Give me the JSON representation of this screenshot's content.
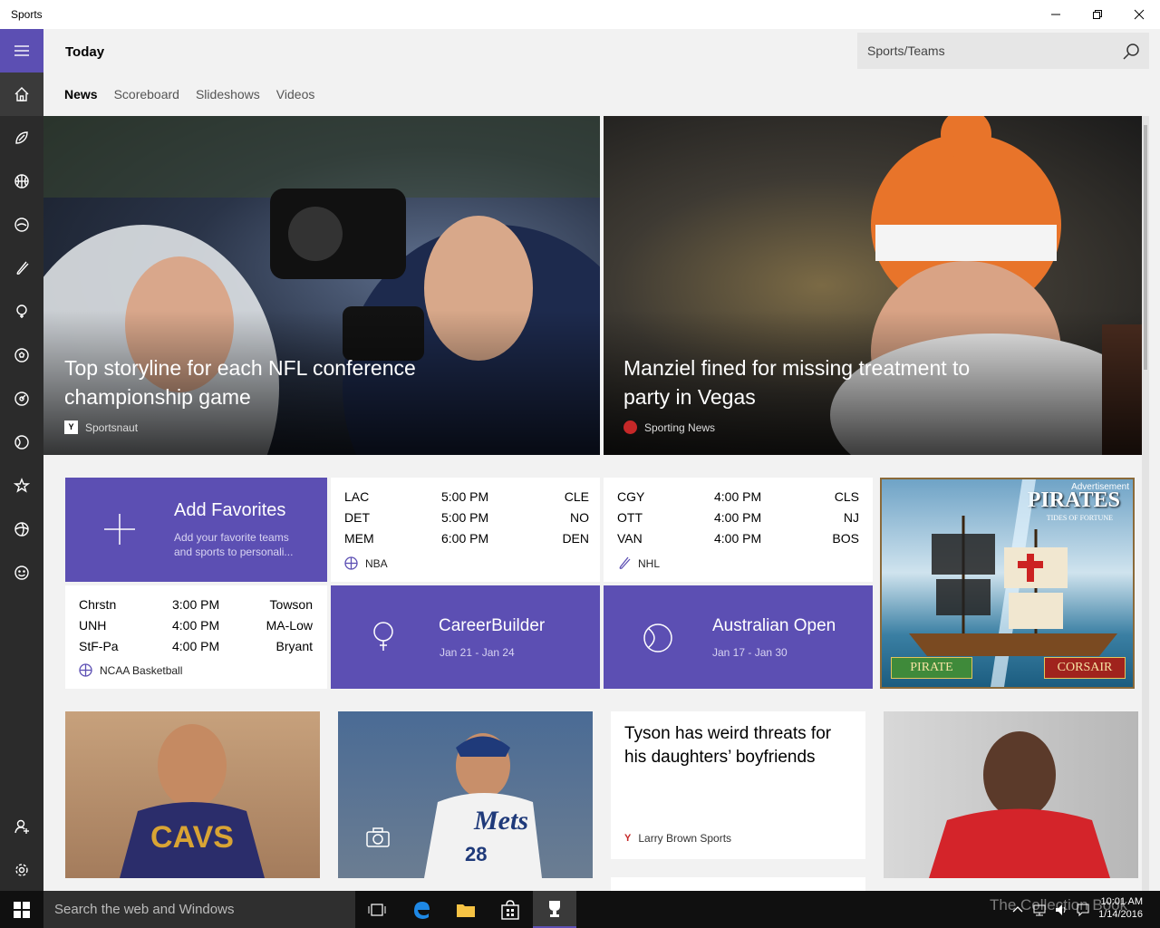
{
  "window": {
    "title": "Sports"
  },
  "header": {
    "page_title": "Today",
    "search_placeholder": "Sports/Teams",
    "tabs": [
      {
        "label": "News",
        "active": true
      },
      {
        "label": "Scoreboard",
        "active": false
      },
      {
        "label": "Slideshows",
        "active": false
      },
      {
        "label": "Videos",
        "active": false
      }
    ]
  },
  "sidebar": {
    "items": [
      {
        "icon": "home-icon",
        "active": true
      },
      {
        "icon": "football-icon"
      },
      {
        "icon": "basketball-icon"
      },
      {
        "icon": "hockey-puck-icon"
      },
      {
        "icon": "hockey-stick-icon"
      },
      {
        "icon": "golf-icon"
      },
      {
        "icon": "soccer-ball-icon"
      },
      {
        "icon": "racing-icon"
      },
      {
        "icon": "tennis-icon"
      },
      {
        "icon": "favorites-icon"
      },
      {
        "icon": "more-sports-icon"
      },
      {
        "icon": "fantasy-icon"
      }
    ],
    "bottom": [
      {
        "icon": "account-icon"
      },
      {
        "icon": "settings-icon"
      }
    ]
  },
  "heroes": [
    {
      "headline": "Top storyline for each NFL conference championship game",
      "source": "Sportsnaut"
    },
    {
      "headline": "Manziel fined for missing treatment to party in Vegas",
      "source": "Sporting News"
    }
  ],
  "favorites_tile": {
    "title": "Add Favorites",
    "subtitle": "Add your favorite teams and sports to personali..."
  },
  "nba": {
    "league": "NBA",
    "games": [
      {
        "away": "LAC",
        "time": "5:00 PM",
        "home": "CLE"
      },
      {
        "away": "DET",
        "time": "5:00 PM",
        "home": "NO"
      },
      {
        "away": "MEM",
        "time": "6:00 PM",
        "home": "DEN"
      }
    ]
  },
  "nhl": {
    "league": "NHL",
    "games": [
      {
        "away": "CGY",
        "time": "4:00 PM",
        "home": "CLS"
      },
      {
        "away": "OTT",
        "time": "4:00 PM",
        "home": "NJ"
      },
      {
        "away": "VAN",
        "time": "4:00 PM",
        "home": "BOS"
      }
    ]
  },
  "ncaa": {
    "league": "NCAA Basketball",
    "games": [
      {
        "away": "Chrstn",
        "time": "3:00 PM",
        "home": "Towson"
      },
      {
        "away": "UNH",
        "time": "4:00 PM",
        "home": "MA-Low"
      },
      {
        "away": "StF-Pa",
        "time": "4:00 PM",
        "home": "Bryant"
      }
    ]
  },
  "events": [
    {
      "title": "CareerBuilder",
      "dates": "Jan 21 - Jan 24",
      "icon": "golf-icon"
    },
    {
      "title": "Australian Open",
      "dates": "Jan 17 - Jan 30",
      "icon": "tennis-icon"
    }
  ],
  "ad": {
    "label": "Advertisement",
    "brand": "PIRATES",
    "tagline": "TIDES OF FORTUNE",
    "buttons": [
      "PIRATE",
      "CORSAIR"
    ]
  },
  "bottom_story": {
    "headline": "Tyson has weird threats for his daughters’ boyfriends",
    "source": "Larry Brown Sports"
  },
  "taskbar": {
    "search_placeholder": "Search the web and Windows",
    "time": "10:01 AM",
    "date": "1/14/2016",
    "watermark": "The Collection Book"
  },
  "colors": {
    "accent": "#5c4fb3",
    "rail": "#2b2b2b"
  }
}
